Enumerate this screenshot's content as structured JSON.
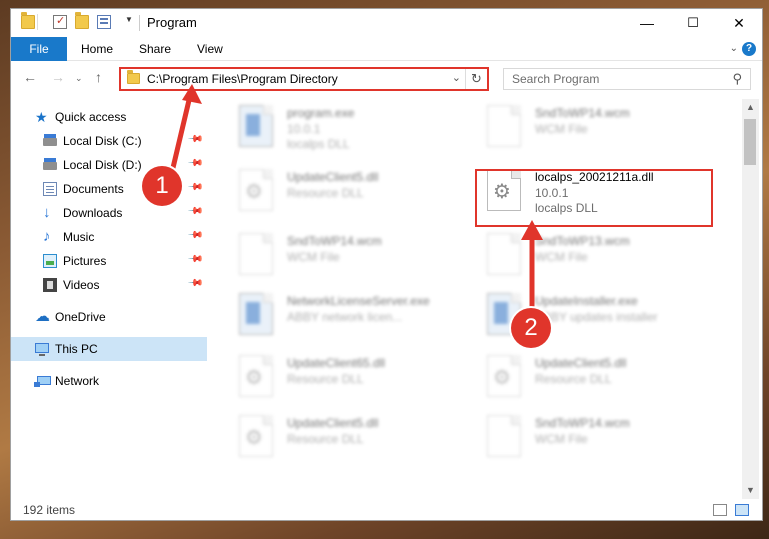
{
  "window": {
    "title": "Program",
    "controls": {
      "minimize": "—",
      "maximize": "☐",
      "close": "✕"
    }
  },
  "ribbon": {
    "tabs": [
      "File",
      "Home",
      "Share",
      "View"
    ]
  },
  "address_bar": {
    "path": "C:\\Program Files\\Program Directory"
  },
  "search": {
    "placeholder": "Search Program"
  },
  "sidebar": {
    "items": [
      {
        "label": "Quick access",
        "icon": "star-icon"
      },
      {
        "label": "Local Disk (C:)",
        "icon": "disk-icon"
      },
      {
        "label": "Local Disk (D:)",
        "icon": "disk-icon"
      },
      {
        "label": "Documents",
        "icon": "documents-icon"
      },
      {
        "label": "Downloads",
        "icon": "download-icon"
      },
      {
        "label": "Music",
        "icon": "music-icon"
      },
      {
        "label": "Pictures",
        "icon": "pictures-icon"
      },
      {
        "label": "Videos",
        "icon": "video-icon"
      },
      {
        "label": "OneDrive",
        "icon": "cloud-icon"
      },
      {
        "label": "This PC",
        "icon": "computer-icon"
      },
      {
        "label": "Network",
        "icon": "network-icon"
      }
    ]
  },
  "files": [
    {
      "name": "program.exe",
      "line2": "10.0.1",
      "line3": "localps DLL"
    },
    {
      "name": "SndToWP14.wcm",
      "line2": "WCM File",
      "line3": ""
    },
    {
      "name": "UpdateClient5.dll",
      "line2": "Resource DLL",
      "line3": ""
    },
    {
      "name": "localps_20021211a.dll",
      "line2": "10.0.1",
      "line3": "localps DLL"
    },
    {
      "name": "SndToWP14.wcm",
      "line2": "WCM File",
      "line3": ""
    },
    {
      "name": "SndToWP13.wcm",
      "line2": "WCM File",
      "line3": ""
    },
    {
      "name": "NetworkLicenseServer.exe",
      "line2": "ABBY network licen...",
      "line3": ""
    },
    {
      "name": "UpdateInstaller.exe",
      "line2": "ABBY updates installer",
      "line3": ""
    },
    {
      "name": "UpdateClient65.dll",
      "line2": "Resource DLL",
      "line3": ""
    },
    {
      "name": "UpdateClient5.dll",
      "line2": "Resource DLL",
      "line3": ""
    },
    {
      "name": "UpdateClient5.dll",
      "line2": "Resource DLL",
      "line3": ""
    },
    {
      "name": "SndToWP14.wcm",
      "line2": "WCM File",
      "line3": ""
    }
  ],
  "status": {
    "item_count": "192 items"
  },
  "callouts": [
    "1",
    "2"
  ],
  "colors": {
    "accent": "#1979ca",
    "highlight": "#e0352b",
    "selection": "#cce4f7"
  }
}
